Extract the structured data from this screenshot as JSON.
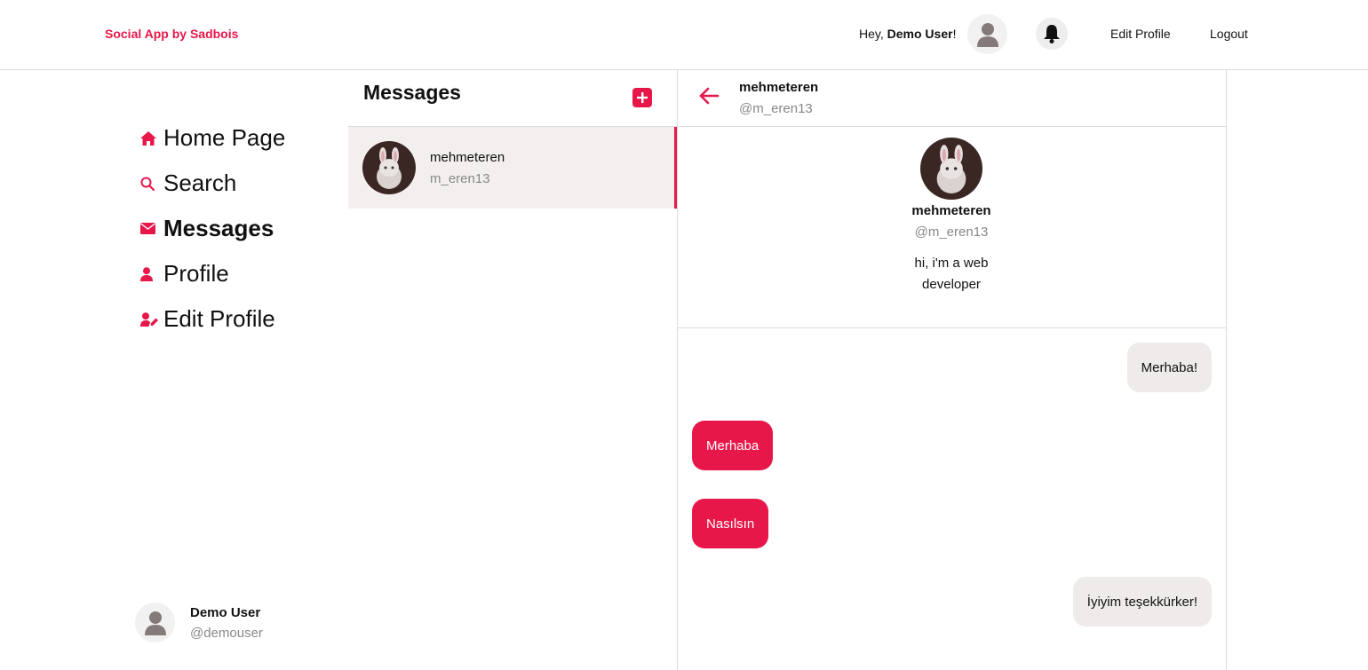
{
  "header": {
    "brand": "Social App by Sadbois",
    "greeting_prefix": "Hey, ",
    "greeting_name": "Demo User",
    "greeting_suffix": "!",
    "edit_profile": "Edit Profile",
    "logout": "Logout"
  },
  "sidebar": {
    "items": [
      {
        "label": "Home Page",
        "icon": "home-icon",
        "active": false
      },
      {
        "label": "Search",
        "icon": "search-icon",
        "active": false
      },
      {
        "label": "Messages",
        "icon": "envelope-icon",
        "active": true
      },
      {
        "label": "Profile",
        "icon": "user-icon",
        "active": false
      },
      {
        "label": "Edit Profile",
        "icon": "user-edit-icon",
        "active": false
      }
    ],
    "current_user": {
      "name": "Demo User",
      "handle": "@demouser"
    }
  },
  "messages_panel": {
    "title": "Messages",
    "conversations": [
      {
        "name": "mehmeteren",
        "handle": "m_eren13",
        "selected": true
      }
    ]
  },
  "chat": {
    "name": "mehmeteren",
    "handle": "@m_eren13",
    "profile": {
      "name": "mehmeteren",
      "handle": "@m_eren13",
      "bio": "hi, i'm a web developer"
    },
    "messages": [
      {
        "text": "Merhaba!",
        "from": "them"
      },
      {
        "text": "Merhaba",
        "from": "me"
      },
      {
        "text": "Nasılsın",
        "from": "me"
      },
      {
        "text": "İyiyim teşekkürker!",
        "from": "them"
      }
    ]
  },
  "colors": {
    "accent": "#e8174a",
    "bubble_in": "#efebea",
    "selected_bg": "#f3efee"
  }
}
